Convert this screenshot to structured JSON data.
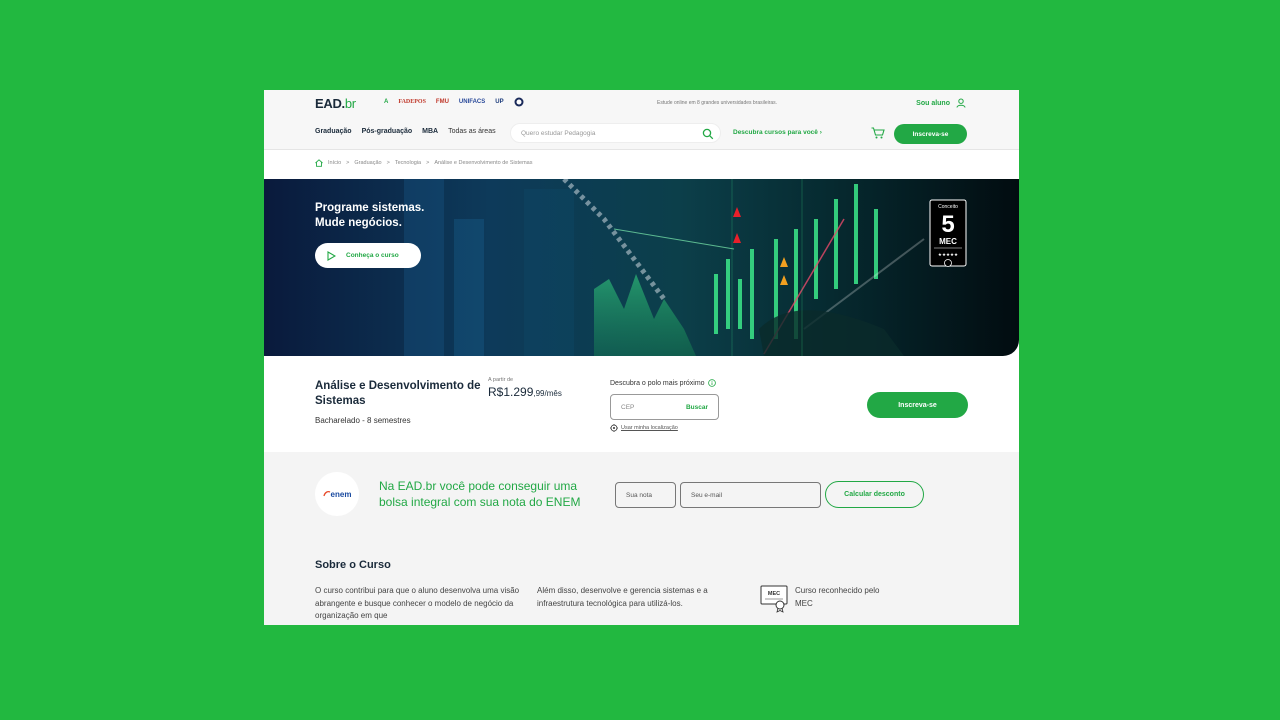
{
  "brand": {
    "logo_main": "EAD.",
    "logo_suffix": "br"
  },
  "universities": [
    {
      "name": "A",
      "color": "#22a845"
    },
    {
      "name": "FADEPOS",
      "color": "#c0392b"
    },
    {
      "name": "FMU",
      "color": "#c0392b"
    },
    {
      "name": "UNIFACS",
      "color": "#2a4a9a"
    },
    {
      "name": "UP",
      "color": "#1a3a7a"
    }
  ],
  "topbar": {
    "note": "Estude online em 8 grandes universidades brasileiras.",
    "sou_aluno": "Sou aluno"
  },
  "nav": {
    "links": [
      "Graduação",
      "Pós-graduação",
      "MBA",
      "Todas as áreas"
    ],
    "search_placeholder": "Quero estudar Pedagogia",
    "descubra": "Descubra cursos para você",
    "inscreva": "Inscreva-se"
  },
  "breadcrumb": [
    "Início",
    ">",
    "Graduação",
    ">",
    "Tecnologia",
    ">",
    "Análise e Desenvolvimento de Sistemas"
  ],
  "hero": {
    "title_line1": "Programe sistemas.",
    "title_line2": "Mude negócios.",
    "cta": "Conheça o curso",
    "badge_top": "Conceito",
    "badge_number": "5",
    "badge_label": "MEC",
    "badge_stars": "★★★★★"
  },
  "course": {
    "name": "Análise e Desenvolvimento de Sistemas",
    "sub": "Bacharelado - 8 semestres",
    "price_label": "A partir de",
    "price_main": "R$1.299",
    "price_cents": ",99/mês",
    "polo_label": "Descubra o polo mais próximo",
    "cep_placeholder": "CEP",
    "buscar": "Buscar",
    "use_location": "Usar minha localização",
    "inscreva": "Inscreva-se"
  },
  "enem": {
    "logo_text": "enem",
    "text": "Na EAD.br você pode conseguir uma bolsa integral com sua nota do ENEM",
    "nota_placeholder": "Sua nota",
    "email_placeholder": "Seu e-mail",
    "button": "Calcular desconto"
  },
  "sobre": {
    "title": "Sobre o Curso",
    "col1": "O curso contribui para que o aluno desenvolva uma visão abrangente e busque conhecer o modelo de negócio da organização em que",
    "col2": "Além disso, desenvolve e gerencia sistemas e a infraestrutura tecnológica para utilizá-los.",
    "mec_icon_label": "MEC",
    "mec_text": "Curso reconhecido pelo MEC"
  },
  "colors": {
    "background": "#22b840",
    "accent": "#22a845",
    "dark": "#1a2a3a"
  }
}
